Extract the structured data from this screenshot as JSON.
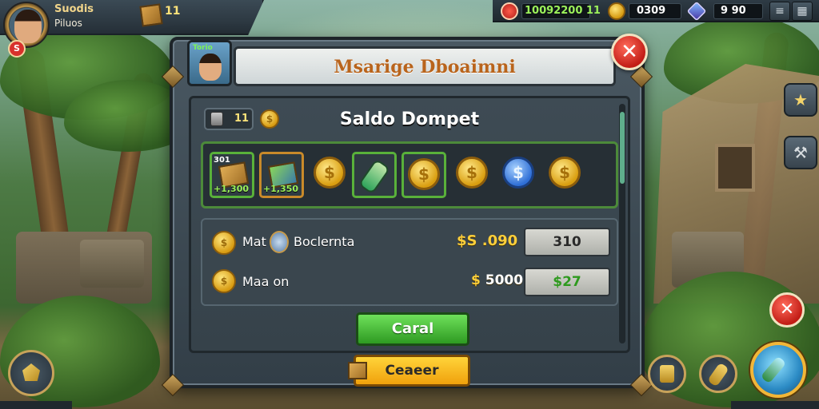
{
  "player": {
    "name": "Suodis",
    "subtitle": "Piluos",
    "level_badge": "S",
    "crate_count": "11"
  },
  "resources": {
    "red_value": "10092200 11",
    "coin_value": "0309",
    "gem_value": "9 90"
  },
  "hud_buttons": {
    "menu_icon": "≡",
    "grid_icon": "▦"
  },
  "dialog": {
    "title": "Msarige Dboaimni",
    "portrait_tag": "Torio",
    "close_icon": "✕",
    "wallet_title": "Saldo Dompet",
    "wallet_chip_value": "11",
    "wallet_coin_symbol": "$",
    "items": [
      {
        "type": "crate",
        "tag": "301",
        "label": "+1,300",
        "frame": "green"
      },
      {
        "type": "gems",
        "label": "+1,350",
        "frame": "gold"
      },
      {
        "type": "coin",
        "symbol": "$",
        "frame": "none"
      },
      {
        "type": "potion",
        "frame": "green"
      },
      {
        "type": "coin",
        "symbol": "$",
        "frame": "green"
      },
      {
        "type": "coin",
        "symbol": "$",
        "frame": "none"
      },
      {
        "type": "coin-blue",
        "symbol": "$",
        "frame": "none"
      },
      {
        "type": "coin",
        "symbol": "$",
        "frame": "none"
      }
    ],
    "rows": [
      {
        "label_a": "Mat",
        "label_b": "Boclernta",
        "amount": "$S .090",
        "value": "310"
      },
      {
        "label_a": "Maa on",
        "amount_symbol": "$",
        "amount": "5000",
        "value": "$27"
      }
    ],
    "primary_button": "Caral",
    "secondary_button": "Ceaeer"
  },
  "side": {
    "star_icon": "★",
    "wrench_icon": "⚒",
    "close_icon": "✕"
  },
  "colors": {
    "accent_gold": "#ffcf3a",
    "confirm_green": "#2e9a22",
    "close_red": "#c21d16",
    "title_orange": "#b9641c"
  }
}
